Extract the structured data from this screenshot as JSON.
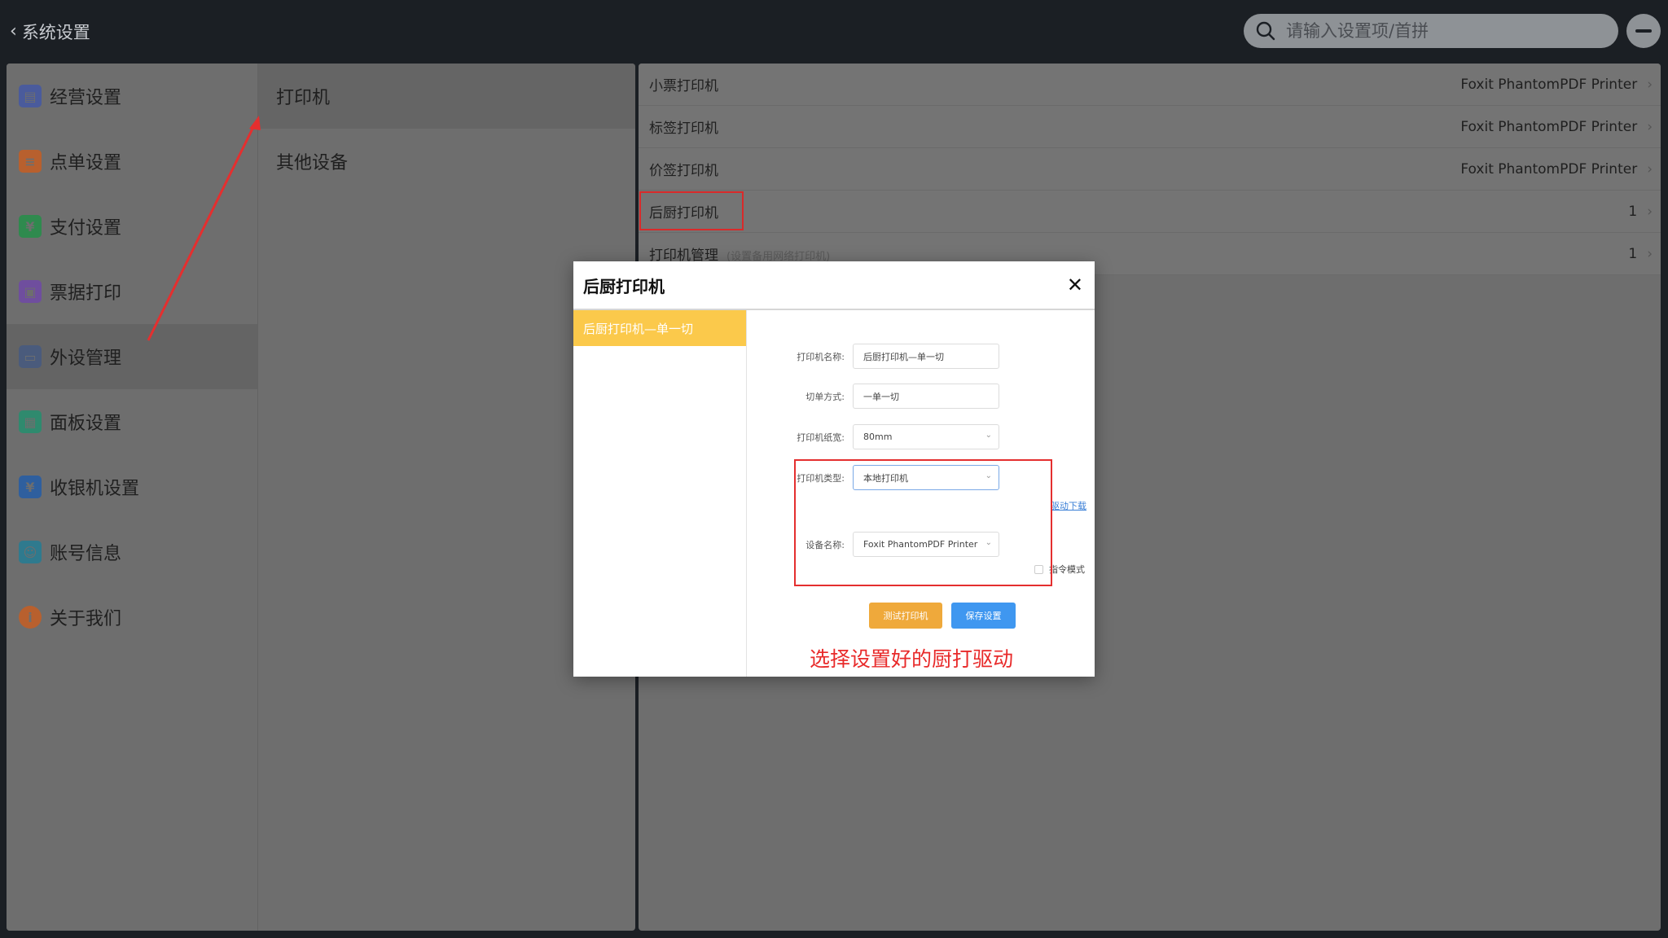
{
  "topbar": {
    "back_label": "系统设置",
    "search_placeholder": "请输入设置项/首拼"
  },
  "categories": [
    {
      "label": "经营设置",
      "icon": "shop-icon",
      "color": "#4a5b9c"
    },
    {
      "label": "点单设置",
      "icon": "order-icon",
      "color": "#b8602e"
    },
    {
      "label": "支付设置",
      "icon": "yuan-icon",
      "color": "#2f8a4e"
    },
    {
      "label": "票据打印",
      "icon": "print-icon",
      "color": "#6f4e9e"
    },
    {
      "label": "外设管理",
      "icon": "device-icon",
      "color": "#4a5b7c"
    },
    {
      "label": "面板设置",
      "icon": "panel-icon",
      "color": "#2f8a6e"
    },
    {
      "label": "收银机设置",
      "icon": "cashier-icon",
      "color": "#2f5f9e"
    },
    {
      "label": "账号信息",
      "icon": "account-icon",
      "color": "#2f7a8e"
    },
    {
      "label": "关于我们",
      "icon": "info-icon",
      "color": "#b8602e"
    }
  ],
  "active_category": "外设管理",
  "subcategories": [
    {
      "label": "打印机"
    },
    {
      "label": "其他设备"
    }
  ],
  "settings_rows": [
    {
      "label": "小票打印机",
      "value": "Foxit PhantomPDF Printer",
      "hint": ""
    },
    {
      "label": "标签打印机",
      "value": "Foxit PhantomPDF Printer",
      "hint": ""
    },
    {
      "label": "价签打印机",
      "value": "Foxit PhantomPDF Printer",
      "hint": ""
    },
    {
      "label": "后厨打印机",
      "value": "1",
      "hint": ""
    },
    {
      "label": "打印机管理",
      "value": "1",
      "hint": "(设置备用网络打印机)"
    }
  ],
  "modal": {
    "title": "后厨打印机",
    "close_label": "✕",
    "printer_item": "后厨打印机—单一切",
    "form": {
      "name_label": "打印机名称:",
      "name_value": "后厨打印机—单一切",
      "cut_label": "切单方式:",
      "cut_value": "一单一切",
      "width_label": "打印机纸宽:",
      "width_value": "80mm",
      "type_label": "打印机类型:",
      "type_value": "本地打印机",
      "driver_link": "驱动下载",
      "device_label": "设备名称:",
      "device_value": "Foxit PhantomPDF Printer",
      "command_mode": "指令模式"
    },
    "test_button": "测试打印机",
    "save_button": "保存设置"
  },
  "annotation_text": "选择设置好的厨打驱动",
  "colors": {
    "accent_yellow": "#fbc94b",
    "test_orange": "#efa93b",
    "save_blue": "#3f97f0",
    "annotation_red": "#e42f2f"
  }
}
